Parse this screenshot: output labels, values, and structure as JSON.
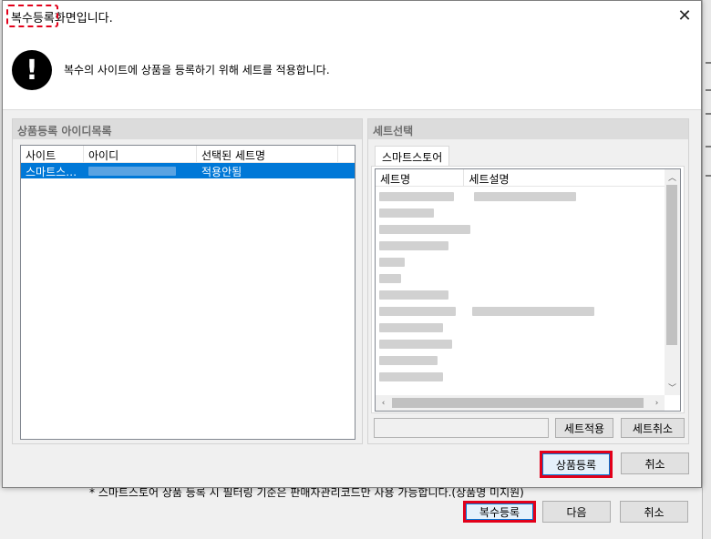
{
  "background": {
    "note": "* 스마트스토어 상품 등록 시 필터링 기준은 판매자관리코드만 사용 가능합니다.(상품명 미지원)",
    "buttons": {
      "register": "복수등록",
      "next": "다음",
      "cancel": "취소"
    }
  },
  "dialog": {
    "title": "복수등록화면입니다.",
    "close_glyph": "✕",
    "info_message": "복수의 사이트에 상품을 등록하기 위해 세트를 적용합니다.",
    "alert_glyph": "!",
    "left_group": {
      "header": "상품등록 아이디목록",
      "columns": [
        "사이트",
        "아이디",
        "선택된 세트명"
      ],
      "rows": [
        {
          "site": "스마트스…",
          "status": "적용안됨"
        }
      ]
    },
    "right_group": {
      "header": "세트선택",
      "tab": "스마트스토어",
      "columns": [
        "세트명",
        "세트설명"
      ],
      "scroll_up": "︿",
      "scroll_down": "﹀",
      "scroll_left": "‹",
      "scroll_right": "›",
      "apply_button": "세트적용",
      "cancel_set_button": "세트취소"
    },
    "register_button": "상품등록",
    "cancel_button": "취소"
  },
  "colors": {
    "highlight_red": "#e2001a",
    "selection_blue": "#0078d7"
  }
}
